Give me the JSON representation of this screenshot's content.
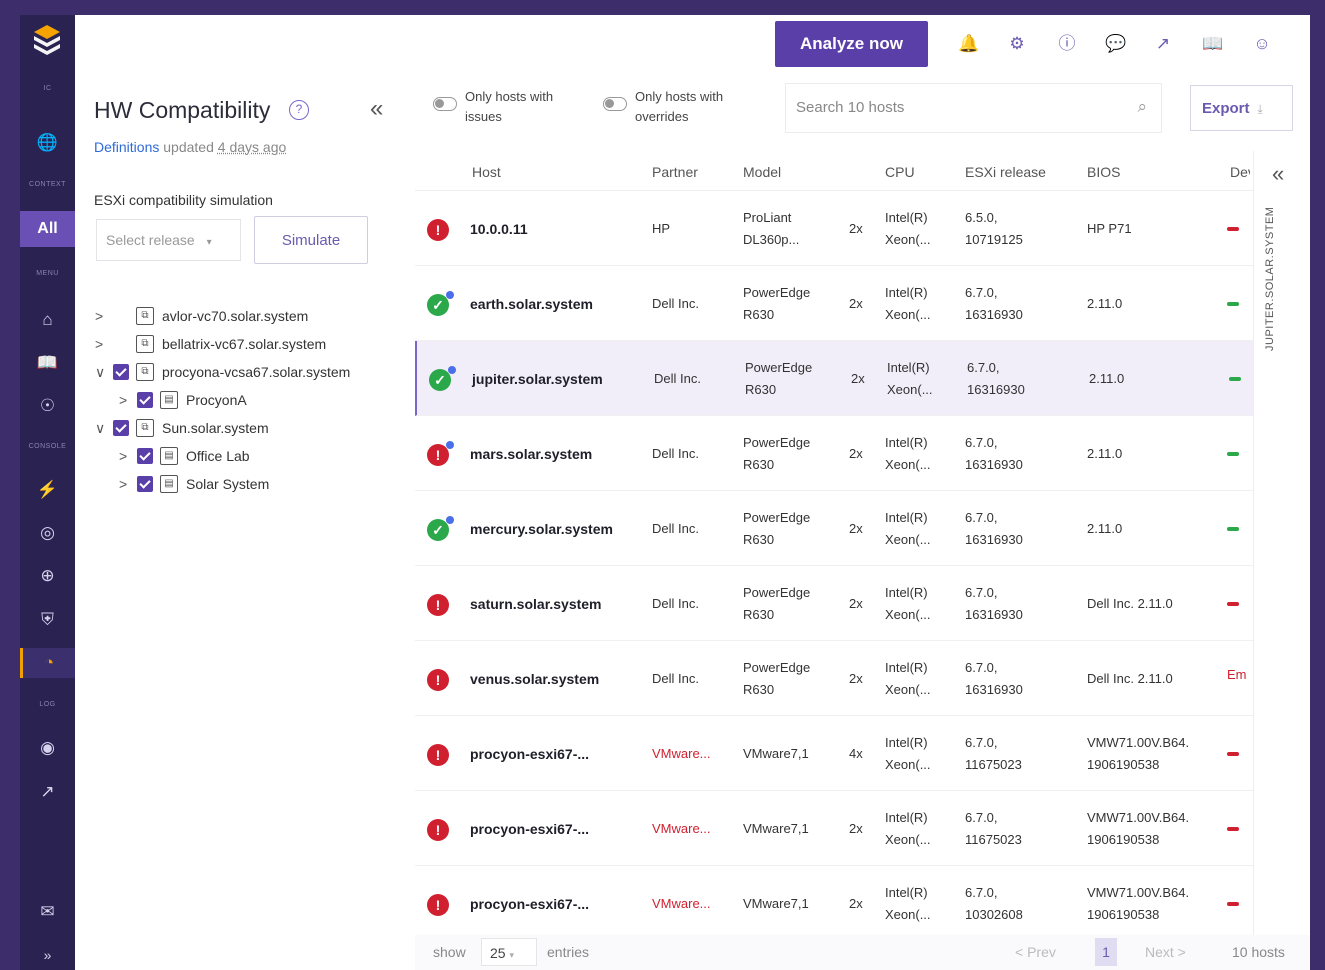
{
  "rail": {
    "sections": [
      "IC",
      "CONTEXT",
      "MENU",
      "CONSOLE",
      "LOG"
    ],
    "all_label": "All"
  },
  "topbar": {
    "analyze_label": "Analyze now",
    "icons": [
      "bell-icon",
      "gear-icon",
      "help-icon",
      "chat-icon",
      "link-icon",
      "book-icon",
      "user-icon"
    ]
  },
  "left": {
    "title": "HW Compatibility",
    "definitions_link": "Definitions",
    "definitions_text": "updated",
    "definitions_age": "4 days ago",
    "simulation_label": "ESXi compatibility simulation",
    "select_placeholder": "Select release",
    "simulate_label": "Simulate",
    "tree": [
      {
        "label": "avlor-vc70.solar.system",
        "level": 0,
        "expanded": false,
        "checked": false
      },
      {
        "label": "bellatrix-vc67.solar.system",
        "level": 0,
        "expanded": false,
        "checked": false
      },
      {
        "label": "procyona-vcsa67.solar.system",
        "level": 0,
        "expanded": true,
        "checked": true
      },
      {
        "label": "ProcyonA",
        "level": 1,
        "expanded": false,
        "checked": true
      },
      {
        "label": "Sun.solar.system",
        "level": 0,
        "expanded": true,
        "checked": true
      },
      {
        "label": "Office Lab",
        "level": 1,
        "expanded": false,
        "checked": true
      },
      {
        "label": "Solar System",
        "level": 1,
        "expanded": false,
        "checked": true
      }
    ]
  },
  "filters": {
    "only_issues": "Only hosts with issues",
    "only_overrides": "Only hosts with overrides",
    "search_placeholder": "Search 10 hosts",
    "export_label": "Export"
  },
  "table": {
    "headers": [
      "Host",
      "Partner",
      "Model",
      "CPU",
      "ESXi release",
      "BIOS",
      "Dev"
    ],
    "rows": [
      {
        "status": "err",
        "host": "10.0.0.11",
        "partner": "HP",
        "model1": "ProLiant",
        "model2": "DL360p...",
        "cpu_count": "2x",
        "cpu1": "Intel(R)",
        "cpu2": "Xeon(...",
        "rel1": "6.5.0,",
        "rel2": "10719125",
        "bios1": "HP P71",
        "bios2": "",
        "dev": "r",
        "selected": false,
        "partner_vm": false
      },
      {
        "status": "ok",
        "host": "earth.solar.system",
        "partner": "Dell Inc.",
        "model1": "PowerEdge",
        "model2": "R630",
        "cpu_count": "2x",
        "cpu1": "Intel(R)",
        "cpu2": "Xeon(...",
        "rel1": "6.7.0,",
        "rel2": "16316930",
        "bios1": "2.11.0",
        "bios2": "",
        "dev": "g",
        "selected": false,
        "partner_vm": false
      },
      {
        "status": "ok",
        "host": "jupiter.solar.system",
        "partner": "Dell Inc.",
        "model1": "PowerEdge",
        "model2": "R630",
        "cpu_count": "2x",
        "cpu1": "Intel(R)",
        "cpu2": "Xeon(...",
        "rel1": "6.7.0,",
        "rel2": "16316930",
        "bios1": "2.11.0",
        "bios2": "",
        "dev": "g",
        "selected": true,
        "partner_vm": false
      },
      {
        "status": "warn",
        "host": "mars.solar.system",
        "partner": "Dell Inc.",
        "model1": "PowerEdge",
        "model2": "R630",
        "cpu_count": "2x",
        "cpu1": "Intel(R)",
        "cpu2": "Xeon(...",
        "rel1": "6.7.0,",
        "rel2": "16316930",
        "bios1": "2.11.0",
        "bios2": "",
        "dev": "g",
        "selected": false,
        "partner_vm": false
      },
      {
        "status": "ok",
        "host": "mercury.solar.system",
        "partner": "Dell Inc.",
        "model1": "PowerEdge",
        "model2": "R630",
        "cpu_count": "2x",
        "cpu1": "Intel(R)",
        "cpu2": "Xeon(...",
        "rel1": "6.7.0,",
        "rel2": "16316930",
        "bios1": "2.11.0",
        "bios2": "",
        "dev": "g",
        "selected": false,
        "partner_vm": false
      },
      {
        "status": "err",
        "host": "saturn.solar.system",
        "partner": "Dell Inc.",
        "model1": "PowerEdge",
        "model2": "R630",
        "cpu_count": "2x",
        "cpu1": "Intel(R)",
        "cpu2": "Xeon(...",
        "rel1": "6.7.0,",
        "rel2": "16316930",
        "bios1": "Dell Inc. 2.11.0",
        "bios2": "",
        "dev": "r",
        "selected": false,
        "partner_vm": false
      },
      {
        "status": "err",
        "host": "venus.solar.system",
        "partner": "Dell Inc.",
        "model1": "PowerEdge",
        "model2": "R630",
        "cpu_count": "2x",
        "cpu1": "Intel(R)",
        "cpu2": "Xeon(...",
        "rel1": "6.7.0,",
        "rel2": "16316930",
        "bios1": "Dell Inc. 2.11.0",
        "bios2": "",
        "dev": "t",
        "dev_text": "Em",
        "selected": false,
        "partner_vm": false
      },
      {
        "status": "err",
        "host": "procyon-esxi67-...",
        "partner": "VMware...",
        "model1": "VMware7,1",
        "model2": "",
        "cpu_count": "4x",
        "cpu1": "Intel(R)",
        "cpu2": "Xeon(...",
        "rel1": "6.7.0,",
        "rel2": "11675023",
        "bios1": "VMW71.00V.B64.",
        "bios2": "1906190538",
        "dev": "r",
        "selected": false,
        "partner_vm": true
      },
      {
        "status": "err",
        "host": "procyon-esxi67-...",
        "partner": "VMware...",
        "model1": "VMware7,1",
        "model2": "",
        "cpu_count": "2x",
        "cpu1": "Intel(R)",
        "cpu2": "Xeon(...",
        "rel1": "6.7.0,",
        "rel2": "11675023",
        "bios1": "VMW71.00V.B64.",
        "bios2": "1906190538",
        "dev": "r",
        "selected": false,
        "partner_vm": true
      },
      {
        "status": "err",
        "host": "procyon-esxi67-...",
        "partner": "VMware...",
        "model1": "VMware7,1",
        "model2": "",
        "cpu_count": "2x",
        "cpu1": "Intel(R)",
        "cpu2": "Xeon(...",
        "rel1": "6.7.0,",
        "rel2": "10302608",
        "bios1": "VMW71.00V.B64.",
        "bios2": "1906190538",
        "dev": "r",
        "selected": false,
        "partner_vm": true
      }
    ]
  },
  "side_panel": {
    "title": "JUPITER.SOLAR.SYSTEM"
  },
  "footer": {
    "show": "show",
    "page_size": "25",
    "entries": "entries",
    "prev": "< Prev",
    "page": "1",
    "next": "Next >",
    "total": "10 hosts"
  }
}
